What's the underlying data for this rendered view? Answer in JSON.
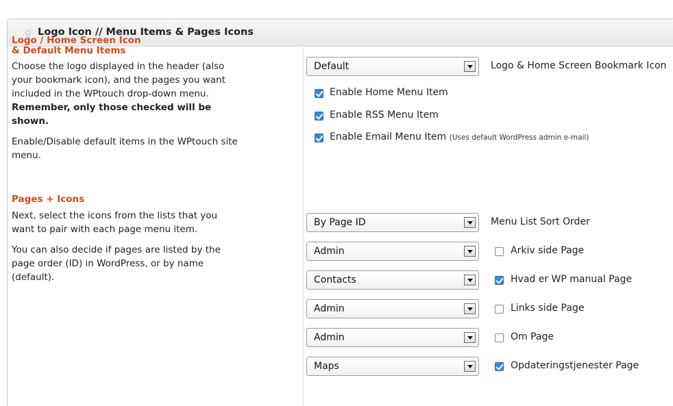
{
  "header": {
    "title": "Logo Icon // Menu Items & Pages Icons"
  },
  "left": {
    "section1_title_line1": "Logo / Home Screen Icon",
    "section1_title_line2": "& Default Menu Items",
    "desc1_line1": "Choose the logo displayed in the header (also",
    "desc1_line2": "your bookmark icon), and the pages you want",
    "desc1_line3": "included in the WPtouch drop-down menu.",
    "desc1_bold_line1": "Remember, only those checked will be",
    "desc1_bold_line2": "shown.",
    "desc2_line1": "Enable/Disable default items in the WPtouch site",
    "desc2_line2": "menu.",
    "section2_title": "Pages + Icons",
    "desc3_line1": "Next, select the icons from the lists that you",
    "desc3_line2": "want to pair with each page menu item.",
    "desc4_line1": "You can also decide if pages are listed by the",
    "desc4_line2": "page order (ID) in WordPress, or by name",
    "desc4_line3": "(default)."
  },
  "logo_select": {
    "value": "Default",
    "label": "Logo & Home Screen Bookmark Icon"
  },
  "menu_items": [
    {
      "label": "Enable Home Menu Item",
      "checked": true,
      "note": ""
    },
    {
      "label": "Enable RSS Menu Item",
      "checked": true,
      "note": ""
    },
    {
      "label": "Enable Email Menu Item",
      "checked": true,
      "note": "(Uses default WordPress admin e-mail)"
    }
  ],
  "sort_select": {
    "value": "By Page ID",
    "label": "Menu List Sort Order"
  },
  "pages": [
    {
      "icon": "Admin",
      "label": "Arkiv side Page",
      "checked": false
    },
    {
      "icon": "Contacts",
      "label": "Hvad er WP manual Page",
      "checked": true
    },
    {
      "icon": "Admin",
      "label": "Links side Page",
      "checked": false
    },
    {
      "icon": "Admin",
      "label": "Om Page",
      "checked": false
    },
    {
      "icon": "Maps",
      "label": "Opdateringstjenester Page",
      "checked": true
    }
  ],
  "colors": {
    "accent": "#d14b1c",
    "checkbox": "#3a86d6"
  }
}
